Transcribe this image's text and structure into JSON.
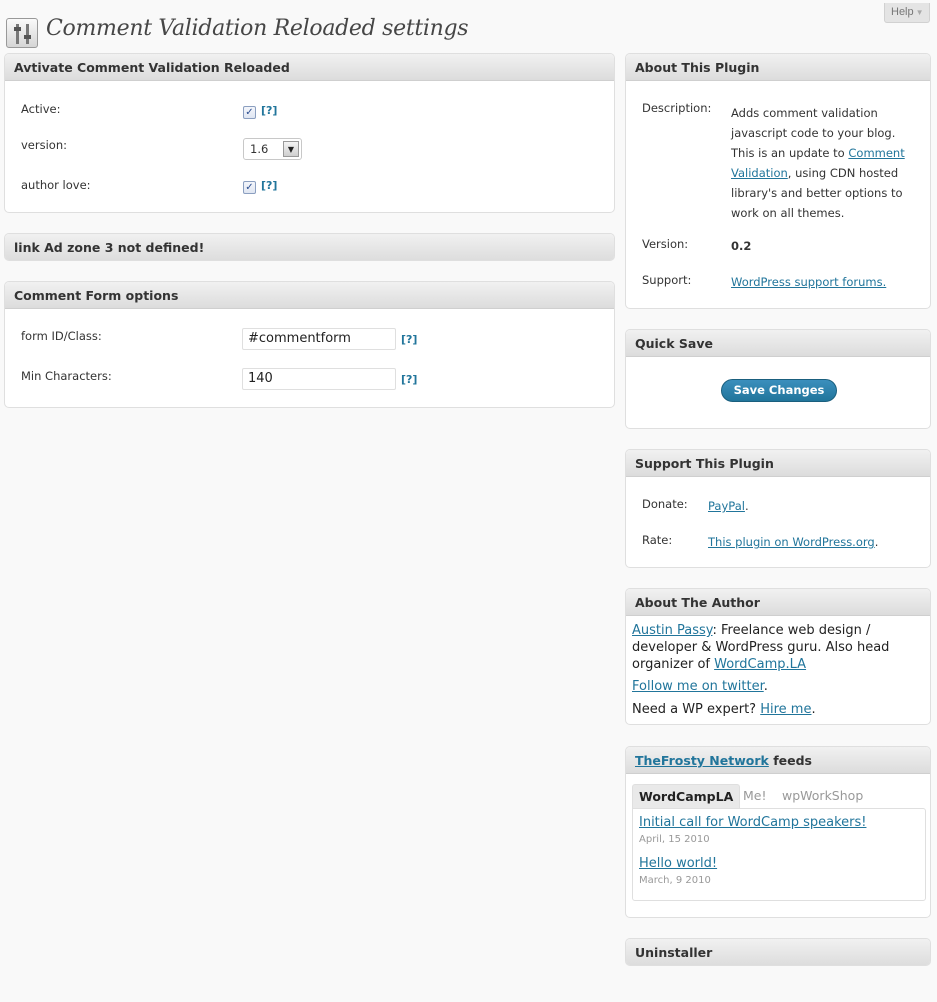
{
  "help": {
    "label": "Help"
  },
  "header": {
    "title": "Comment Validation Reloaded settings"
  },
  "activate_box": {
    "title": "Avtivate Comment Validation Reloaded",
    "active_label": "Active:",
    "active_help": "[?]",
    "version_label": "version:",
    "version_value": "1.6",
    "author_love_label": "author love:",
    "author_love_help": "[?]"
  },
  "ad_box": {
    "title": "link Ad zone 3 not defined!"
  },
  "form_box": {
    "title": "Comment Form options",
    "form_id_label": "form ID/Class:",
    "form_id_value": "#commentform",
    "form_id_help": "[?]",
    "min_chars_label": "Min Characters:",
    "min_chars_value": "140",
    "min_chars_help": "[?]"
  },
  "about_plugin": {
    "title": "About This Plugin",
    "description_label": "Description:",
    "desc_line1": "Adds comment validation",
    "desc_line2": "javascript code to your blog.",
    "desc_line3_pre": "This is an update to ",
    "desc_link1": "Comment",
    "desc_link2": "Validation",
    "desc_line4_post": ", using CDN hosted",
    "desc_line5": "library's and better options to",
    "desc_line6": "work on all themes.",
    "version_label": "Version:",
    "version_value": "0.2",
    "support_label": "Support:",
    "support_link": "WordPress support forums."
  },
  "quick_save": {
    "title": "Quick Save",
    "button_label": "Save Changes"
  },
  "support_plugin": {
    "title": "Support This Plugin",
    "donate_label": "Donate:",
    "donate_link": "PayPal",
    "donate_suffix": ".",
    "rate_label": "Rate:",
    "rate_link": "This plugin on WordPress.org",
    "rate_suffix": "."
  },
  "about_author": {
    "title": "About The Author",
    "author_link": "Austin Passy",
    "line1_post": ": Freelance web design /",
    "line2": "developer & WordPress guru. Also head",
    "line3_pre": "organizer of ",
    "wordcamp_link": "WordCamp.LA",
    "twitter_link": "Follow me on twitter",
    "twitter_suffix": ".",
    "hire_pre": "Need a WP expert? ",
    "hire_link": "Hire me",
    "hire_suffix": "."
  },
  "feeds_box": {
    "network_link": "TheFrosty Network",
    "title_suffix": " feeds",
    "tabs": [
      "WordCampLA",
      "Me!",
      "wpWorkShop"
    ],
    "items": [
      {
        "title": "Initial call for WordCamp speakers!",
        "date": "April, 15 2010"
      },
      {
        "title": "Hello world!",
        "date": "March, 9 2010"
      }
    ]
  },
  "uninstaller": {
    "title": "Uninstaller"
  },
  "colors": {
    "link": "#21759b",
    "button": "#21759b",
    "background": "#f9f9f9"
  },
  "icons": {
    "header": "settings-sliders-icon",
    "select_arrow": "chevron-down-icon"
  }
}
